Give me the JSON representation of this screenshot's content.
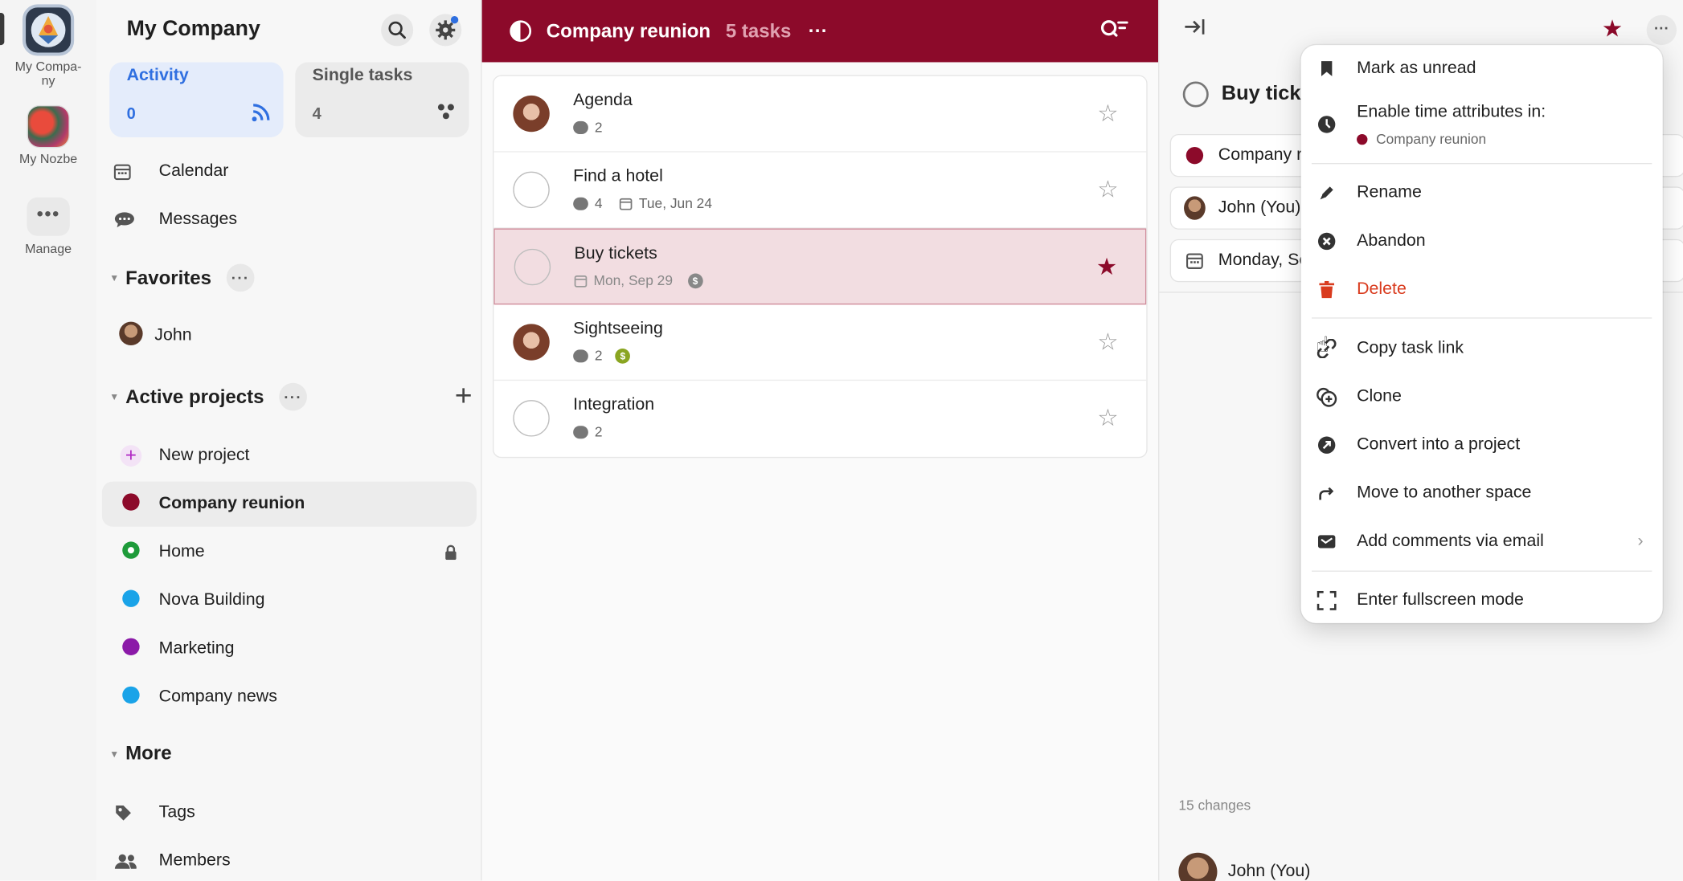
{
  "rail": {
    "items": [
      {
        "label": "My Compa-\nny",
        "label_line1": "My Compa-",
        "label_line2": "ny"
      },
      {
        "label": "My Nozbe"
      },
      {
        "label": "Manage"
      }
    ]
  },
  "sidebar": {
    "title": "My Company",
    "cards": [
      {
        "title": "Activity",
        "count": "0"
      },
      {
        "title": "Single tasks",
        "count": "4"
      }
    ],
    "nav": [
      {
        "label": "Calendar",
        "icon": "calendar-icon"
      },
      {
        "label": "Messages",
        "icon": "messages-icon"
      }
    ],
    "favorites": {
      "title": "Favorites",
      "items": [
        {
          "label": "John"
        }
      ]
    },
    "active_projects": {
      "title": "Active projects",
      "new_project": "New project",
      "items": [
        {
          "label": "Company reunion",
          "color": "#8c0a2a",
          "selected": true
        },
        {
          "label": "Home",
          "color": "#1e9b3a",
          "locked": true
        },
        {
          "label": "Nova Building",
          "color": "#1aa3e8"
        },
        {
          "label": "Marketing",
          "color": "#8b1aa8"
        },
        {
          "label": "Company news",
          "color": "#1aa3e8"
        }
      ]
    },
    "more": {
      "title": "More",
      "items": [
        {
          "label": "Tags",
          "icon": "tag-icon"
        },
        {
          "label": "Members",
          "icon": "members-icon"
        }
      ]
    }
  },
  "project": {
    "title": "Company reunion",
    "task_count": "5 tasks",
    "accent": "#8c0a2a",
    "tasks": [
      {
        "name": "Agenda",
        "comments": "2",
        "avatar": true,
        "starred": false
      },
      {
        "name": "Find a hotel",
        "comments": "4",
        "date": "Tue, Jun 24",
        "avatar": false,
        "starred": false
      },
      {
        "name": "Buy tickets",
        "date": "Mon, Sep 29",
        "coin": "$",
        "avatar": false,
        "starred": true,
        "selected": true
      },
      {
        "name": "Sightseeing",
        "comments": "2",
        "coin": "$",
        "avatar": true,
        "starred": false
      },
      {
        "name": "Integration",
        "comments": "2",
        "avatar": false,
        "starred": false
      }
    ]
  },
  "detail": {
    "title": "Buy ticke",
    "fields": [
      {
        "label": "Company r",
        "icon": "project-dot"
      },
      {
        "label": "John (You)",
        "icon": "avatar"
      },
      {
        "label": "Monday, Se",
        "icon": "calendar-icon"
      }
    ],
    "changes": "15 changes",
    "commenter": "John (You)"
  },
  "menu": {
    "items": [
      {
        "label": "Mark as unread",
        "icon": "bookmark-icon"
      },
      {
        "label": "Enable time attributes in:",
        "icon": "clock-icon",
        "sub": "Company reunion"
      },
      {
        "label": "Rename",
        "icon": "pencil-icon"
      },
      {
        "label": "Abandon",
        "icon": "abandon-icon"
      },
      {
        "label": "Delete",
        "icon": "trash-icon",
        "danger": true
      },
      {
        "label": "Copy task link",
        "icon": "link-icon"
      },
      {
        "label": "Clone",
        "icon": "clone-icon"
      },
      {
        "label": "Convert into a project",
        "icon": "convert-icon"
      },
      {
        "label": "Move to another space",
        "icon": "move-icon"
      },
      {
        "label": "Add comments via email",
        "icon": "email-icon",
        "submenu": true
      },
      {
        "label": "Enter fullscreen mode",
        "icon": "fullscreen-icon"
      }
    ]
  }
}
